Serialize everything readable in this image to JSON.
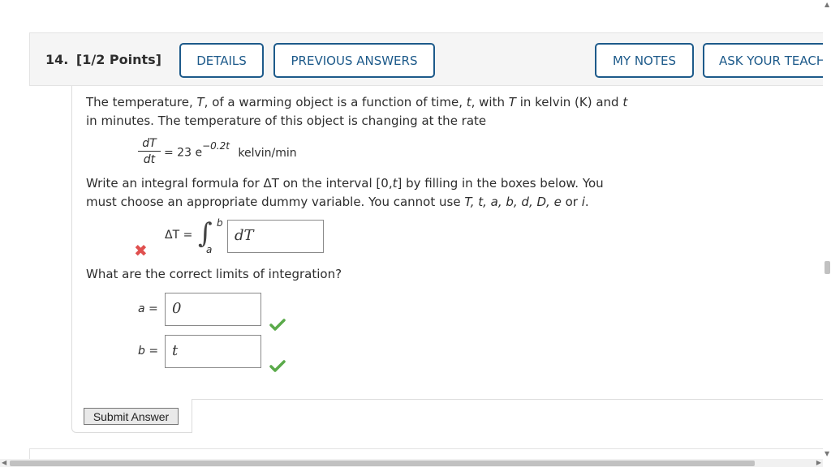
{
  "question": {
    "number_label": "14.",
    "points_label": "[1/2 Points]"
  },
  "toolbar": {
    "details_label": "DETAILS",
    "previous_answers_label": "PREVIOUS ANSWERS",
    "my_notes_label": "MY NOTES",
    "ask_teacher_label": "ASK YOUR TEACH"
  },
  "problem": {
    "intro_1": {
      "a": "The temperature, ",
      "T1": "T",
      "b": ", of a warming object is a function of time, ",
      "t1": "t",
      "c": ", with ",
      "T2": "T",
      "d": " in kelvin (K) and ",
      "t2": "t"
    },
    "intro_2": "in minutes. The temperature of this object is changing at the rate",
    "rate": {
      "numerator": "dT",
      "denominator": "dt",
      "equals_coef": "= 23 e",
      "exponent": "−0.2t",
      "unit": "kelvin/min"
    },
    "instruction_1": {
      "a": "Write an integral formula for ΔT on the interval [0,",
      "t": "t",
      "b": "] by filling in the boxes below. You"
    },
    "instruction_2": {
      "a": "must choose an appropriate dummy variable. You cannot use ",
      "vars": "T, t, a, b, d, D, e",
      "b": " or ",
      "i": "i",
      "c": "."
    },
    "integral": {
      "lhs": "ΔT =",
      "upper_limit": "b",
      "lower_limit": "a",
      "integrand_value": "dT"
    },
    "limits_question": "What are the correct limits of integration?",
    "a_label": "a",
    "b_label": "b",
    "equals": "=",
    "a_value": "0",
    "b_value": "t",
    "submit_label": "Submit Answer"
  },
  "status": {
    "integrand": "incorrect",
    "a": "correct",
    "b": "correct"
  },
  "colors": {
    "accent": "#1d5a8a",
    "correct": "#5aaa4a",
    "incorrect": "#e0504f"
  },
  "icons": {
    "incorrect": "x-mark-icon",
    "correct": "check-mark-icon"
  }
}
